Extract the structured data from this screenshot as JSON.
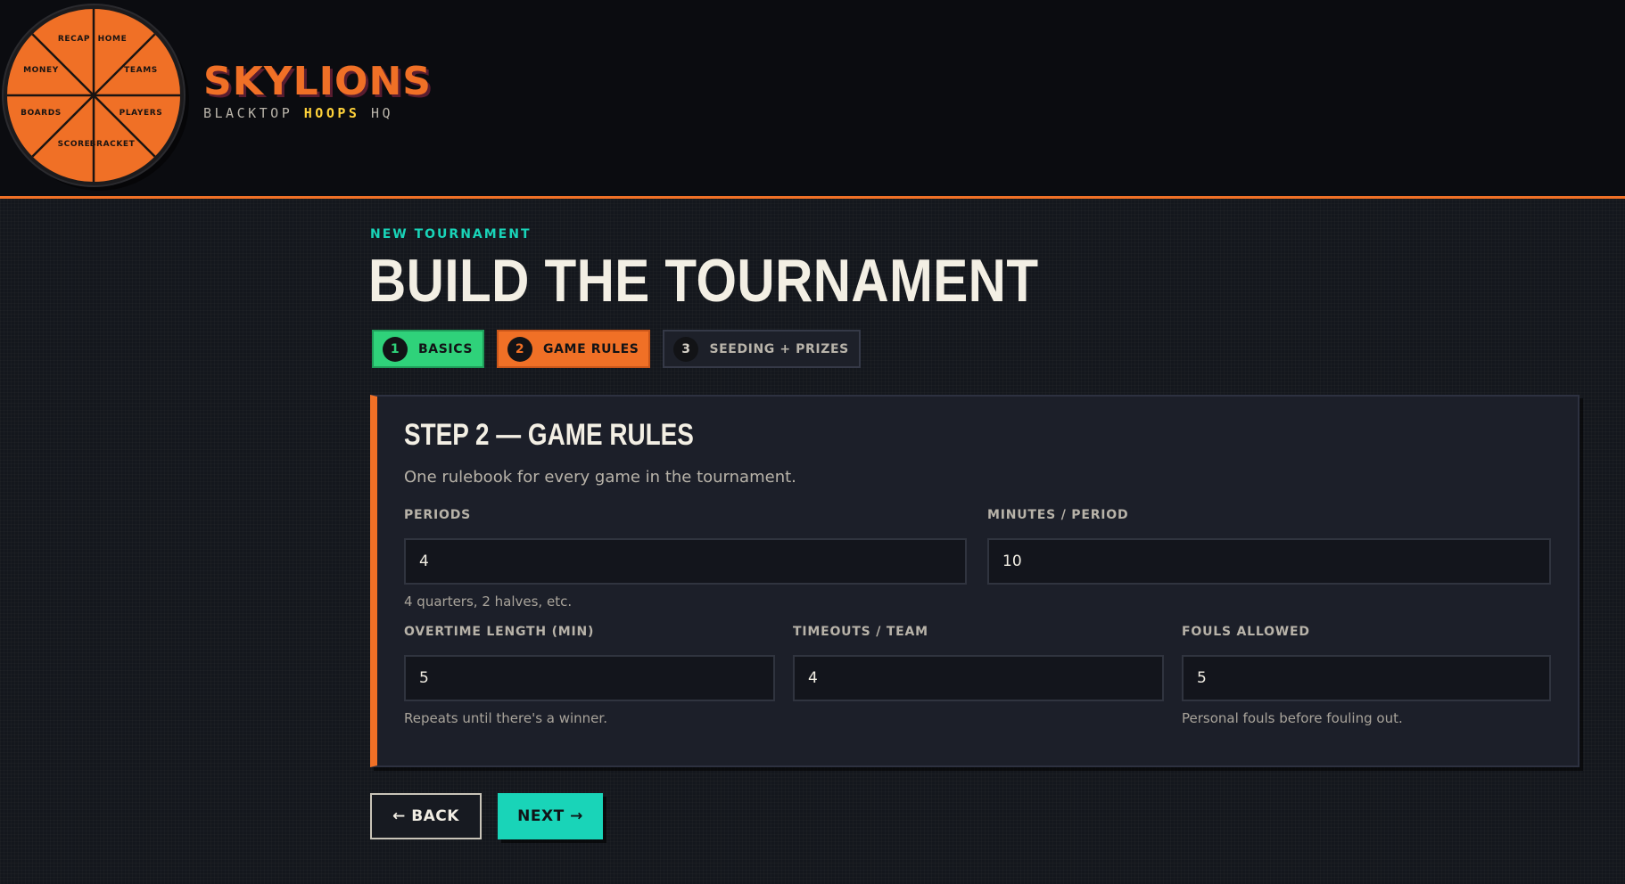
{
  "header": {
    "brand_title": "SKYLIONS",
    "brand_sub_pre": "BLACKTOP ",
    "brand_sub_highlight": "HOOPS",
    "brand_sub_post": " HQ",
    "nav_wheel": {
      "recap": "RECAP",
      "home": "HOME",
      "money": "MONEY",
      "teams": "TEAMS",
      "boards": "BOARDS",
      "players": "PLAYERS",
      "score": "SCORE",
      "bracket": "BRACKET"
    }
  },
  "main": {
    "eyebrow": "NEW TOURNAMENT",
    "title": "BUILD THE TOURNAMENT",
    "steps": [
      {
        "num": "1",
        "label": "BASICS",
        "state": "done"
      },
      {
        "num": "2",
        "label": "GAME RULES",
        "state": "active"
      },
      {
        "num": "3",
        "label": "SEEDING + PRIZES",
        "state": "pending"
      }
    ]
  },
  "card": {
    "title": "STEP 2 — GAME RULES",
    "subtitle": "One rulebook for every game in the tournament.",
    "fields": {
      "periods": {
        "label": "PERIODS",
        "value": "4",
        "hint": "4 quarters, 2 halves, etc."
      },
      "minutes": {
        "label": "MINUTES / PERIOD",
        "value": "10",
        "hint": ""
      },
      "overtime": {
        "label": "OVERTIME LENGTH (MIN)",
        "value": "5",
        "hint": "Repeats until there's a winner."
      },
      "timeouts": {
        "label": "TIMEOUTS / TEAM",
        "value": "4",
        "hint": ""
      },
      "fouls": {
        "label": "FOULS ALLOWED",
        "value": "5",
        "hint": "Personal fouls before fouling out."
      }
    }
  },
  "actions": {
    "back_label": "← BACK",
    "next_label": "NEXT →"
  },
  "colors": {
    "accent_orange": "#f07026",
    "accent_teal": "#19d4b8",
    "accent_green": "#2fd27a",
    "highlight_yellow": "#ffd23a",
    "background": "#14171d"
  }
}
